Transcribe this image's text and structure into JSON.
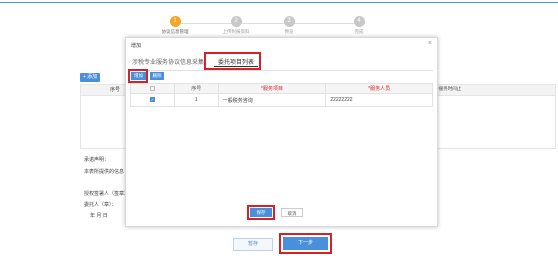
{
  "steps": [
    {
      "num": "1",
      "label": "协议信息管理",
      "active": true
    },
    {
      "num": "2",
      "label": "上传附报资料",
      "active": false
    },
    {
      "num": "3",
      "label": "预览",
      "active": false
    },
    {
      "num": "4",
      "label": "完成",
      "active": false
    }
  ],
  "background": {
    "add_label": "+ 添加",
    "col_seq": "序号",
    "col_right": "*服务时间止",
    "declaration_title": "承诺声明：",
    "declaration_text": "本表所提供的信息",
    "authorized_label": "授权签署人（签章）：",
    "client_label": "委托人（章）：",
    "date_label": "年   月   日",
    "draft_label": "暂存",
    "next_label": "下一步"
  },
  "modal": {
    "title": "增加",
    "close": "×",
    "tab1": "涉税专业服务协议信息采集",
    "tab2": "委托项目列表",
    "add_btn": "增加",
    "del_btn": "删除",
    "columns": [
      "",
      "序号",
      "*服务项目",
      "*服务人员"
    ],
    "rows": [
      {
        "checked": true,
        "seq": "1",
        "project": "一般税务咨询",
        "staff": "22222222"
      }
    ],
    "save_label": "保存",
    "cancel_label": "取消"
  },
  "colors": {
    "accent": "#4a8fd9",
    "highlight": "#d2232a"
  }
}
